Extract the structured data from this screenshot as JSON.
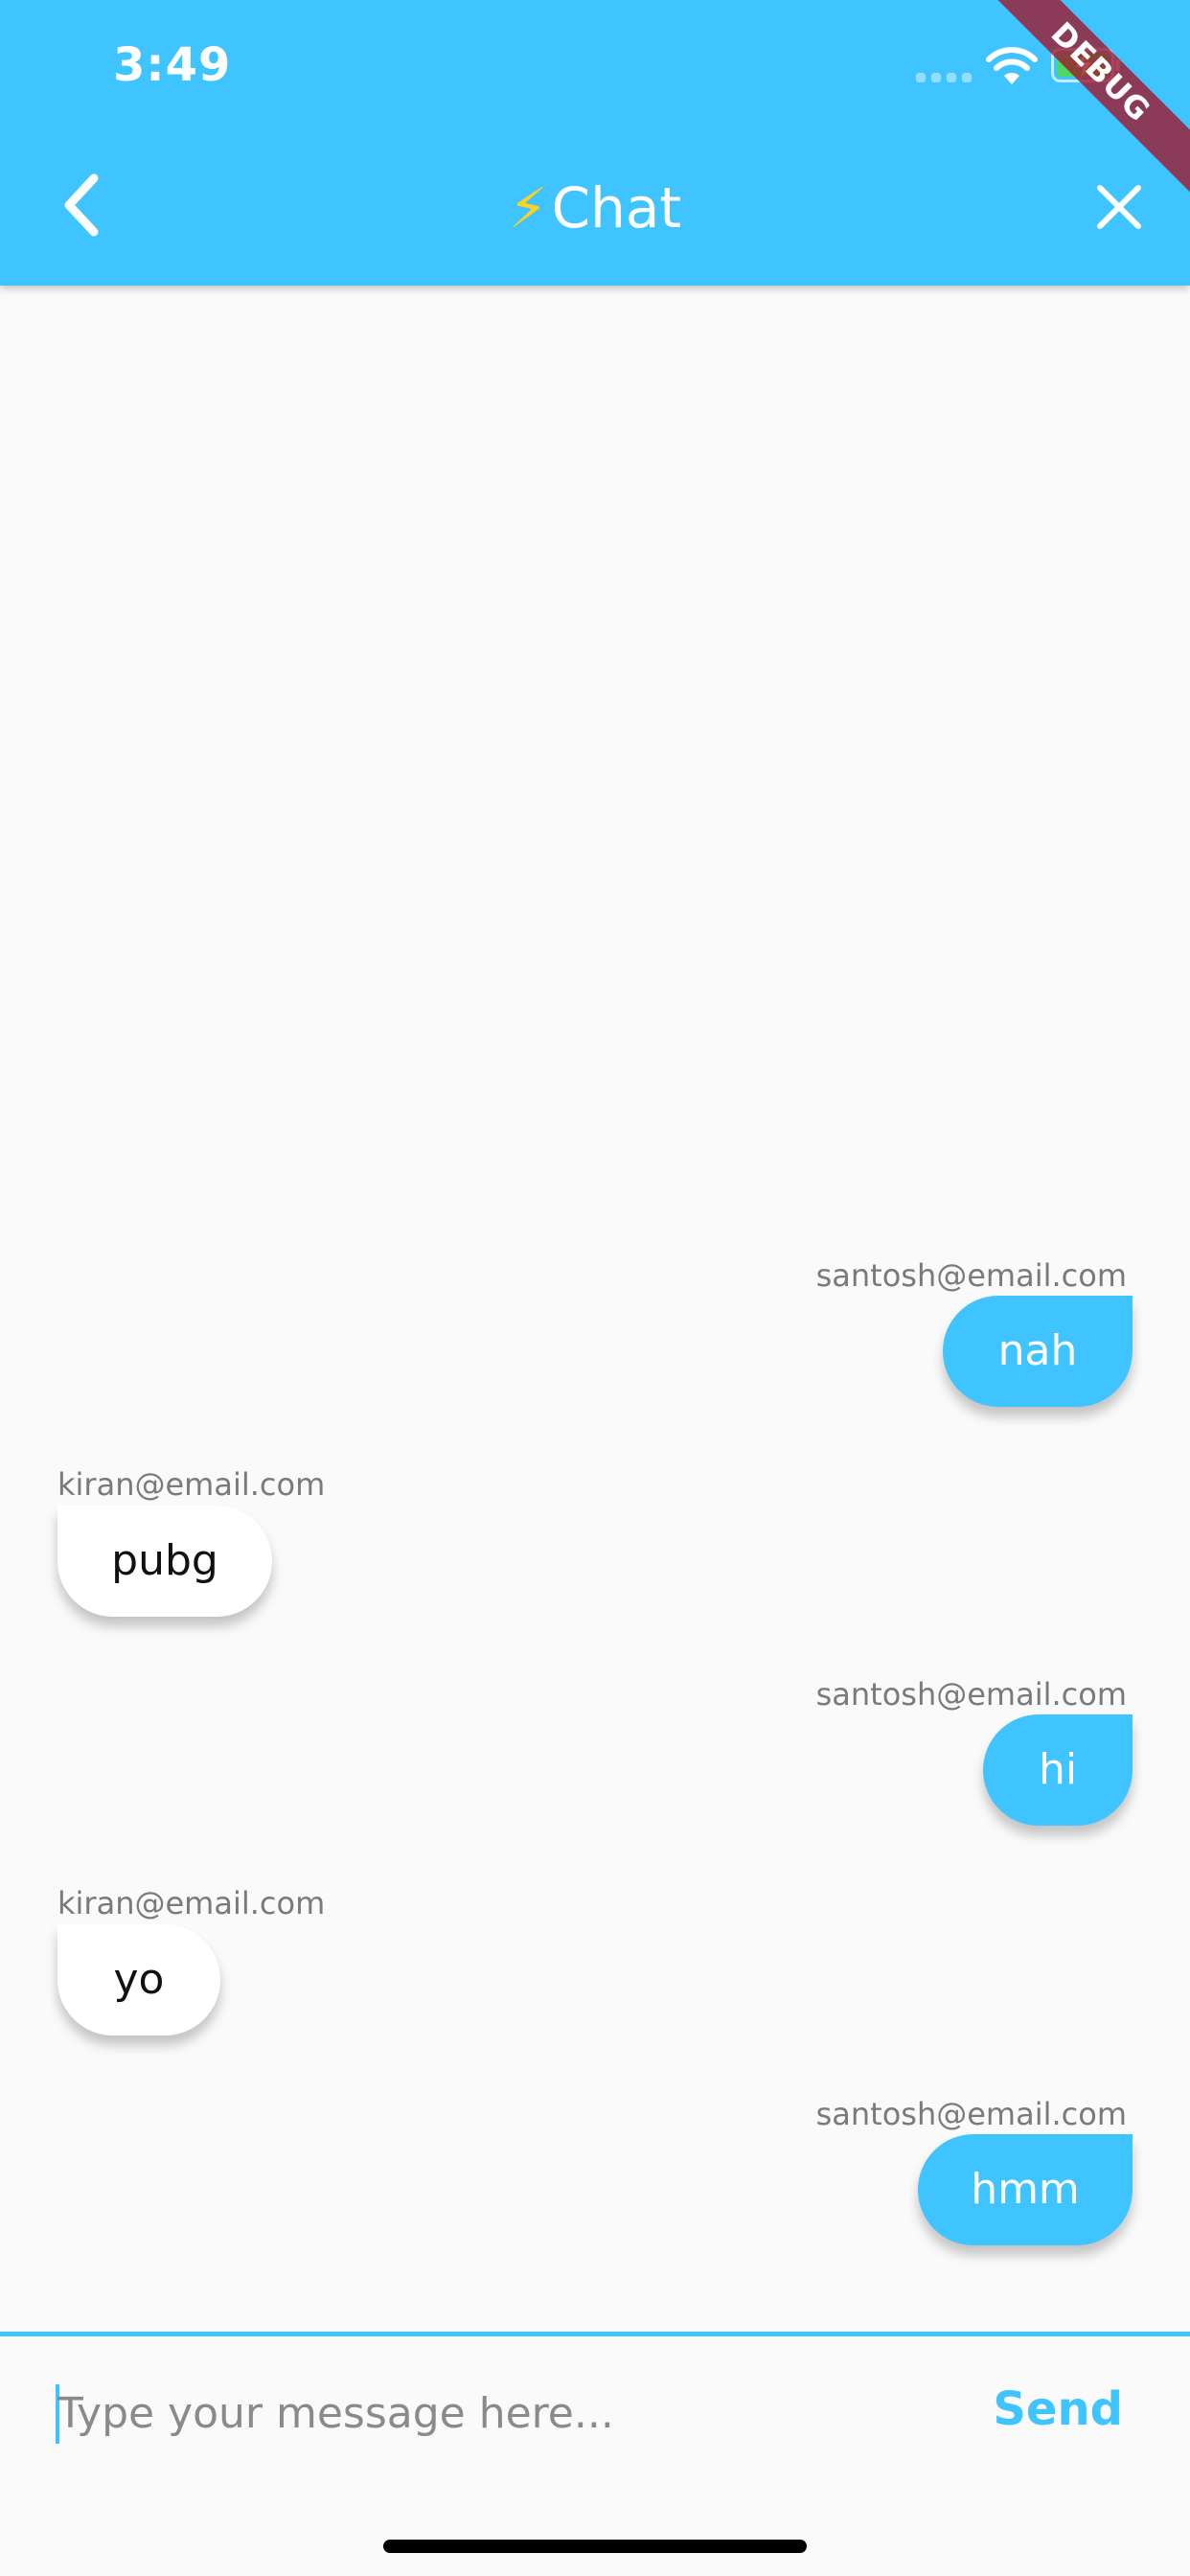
{
  "status_bar": {
    "time": "3:49"
  },
  "app_bar": {
    "bolt": "⚡",
    "title": "Chat",
    "debug_label": "DEBUG",
    "accent_color": "#40c4ff"
  },
  "messages": [
    {
      "sender": "santosh@email.com",
      "text": "nah",
      "is_me": true
    },
    {
      "sender": "kiran@email.com",
      "text": "pubg",
      "is_me": false
    },
    {
      "sender": "santosh@email.com",
      "text": "hi",
      "is_me": true
    },
    {
      "sender": "kiran@email.com",
      "text": "yo",
      "is_me": false
    },
    {
      "sender": "santosh@email.com",
      "text": "hmm",
      "is_me": true
    }
  ],
  "composer": {
    "placeholder": "Type your message here...",
    "value": "",
    "send_label": "Send"
  }
}
